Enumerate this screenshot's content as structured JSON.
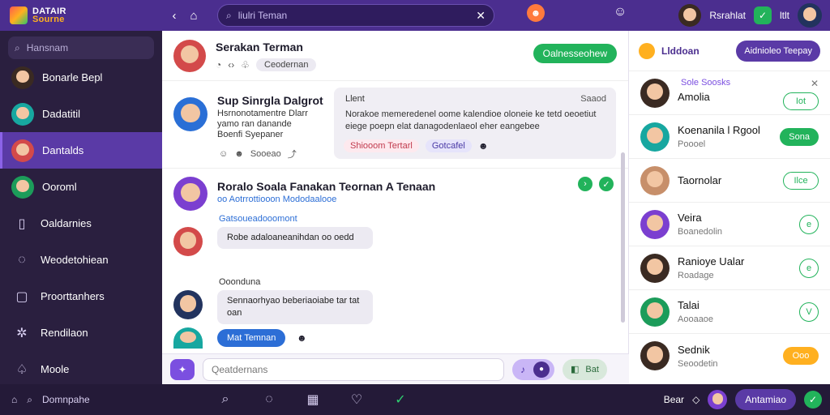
{
  "topbar": {
    "logo_line1": "DATAIR",
    "logo_line2": "Sourne",
    "back_icon": "‹",
    "home_icon": "⌂",
    "search_text": "liulri Teman",
    "pin_icon": "☻",
    "user_name": "Rsrahlat",
    "status": "ltlt"
  },
  "sidebar": {
    "search_placeholder": "Hansnam",
    "items": [
      {
        "label": "Bonarle Bepl"
      },
      {
        "label": "Dadatitil"
      },
      {
        "label": "Dantalds"
      },
      {
        "label": "Ooroml"
      },
      {
        "label": "Oaldarnies"
      },
      {
        "label": "Weodetohiean"
      },
      {
        "label": "Proorttanhers"
      },
      {
        "label": "Rendilaon"
      },
      {
        "label": "Moole"
      }
    ]
  },
  "chat_header": {
    "title": "Serakan Terman",
    "chip": "Ceodernan",
    "action": "Oalnesseohew"
  },
  "thread": {
    "name": "Sup Sinrgla Dalgrot",
    "body": "Hsrnonotamentre Dlarr yamo ran danande Boenfi Syepaner",
    "reacts": "Sooeao",
    "card_label": "Llent",
    "card_author": "Saaod",
    "card_body": "Norakoe memeredenel oome kalendioe oloneie ke tetd oeoetiut eiege poepn elat danagodenlaeol eher eangebee",
    "tag1": "Shiooom Tertarl",
    "tag2": "Gotcafel"
  },
  "group": {
    "name": "Roralo Soala Fanakan Teornan A Tenaan",
    "sub": "oo Aotrrottiooon Mododaalooe",
    "meta1": "Gatsoueadooomont",
    "msg1": "Robe adaloaneanihdan oo oedd",
    "meta2": "Ooonduna",
    "msg2": "Sennaorhyao beberiaoiabe tar tat oan",
    "pill": "Mat Temnan"
  },
  "composer": {
    "placeholder": "Qeatdernans",
    "send_label": "Bat"
  },
  "right": {
    "title": "Llddoan",
    "action": "Aidnioleo Teepay",
    "section": "Sole Soosks",
    "contacts": [
      {
        "name": "Amolia",
        "status": "",
        "action": "Iot",
        "style": "outline"
      },
      {
        "name": "Koenanila l Rgool",
        "status": "Poooel",
        "action": "Sona",
        "style": "fill"
      },
      {
        "name": "Taornolar",
        "status": "",
        "action": "Ilce",
        "style": "outline"
      },
      {
        "name": "Veira",
        "status": "Boanedolin",
        "action": "e",
        "style": "circ"
      },
      {
        "name": "Ranioye Ualar",
        "status": "Roadage",
        "action": "e",
        "style": "circ"
      },
      {
        "name": "Talai",
        "status": "Aooaaoe",
        "action": "V",
        "style": "circ"
      },
      {
        "name": "Sednik",
        "status": "Seoodetin",
        "action": "Ooo",
        "style": "org"
      }
    ]
  },
  "bottombar": {
    "left_label": "Domnpahe",
    "right_label": "Bear",
    "action": "Antamiao"
  }
}
